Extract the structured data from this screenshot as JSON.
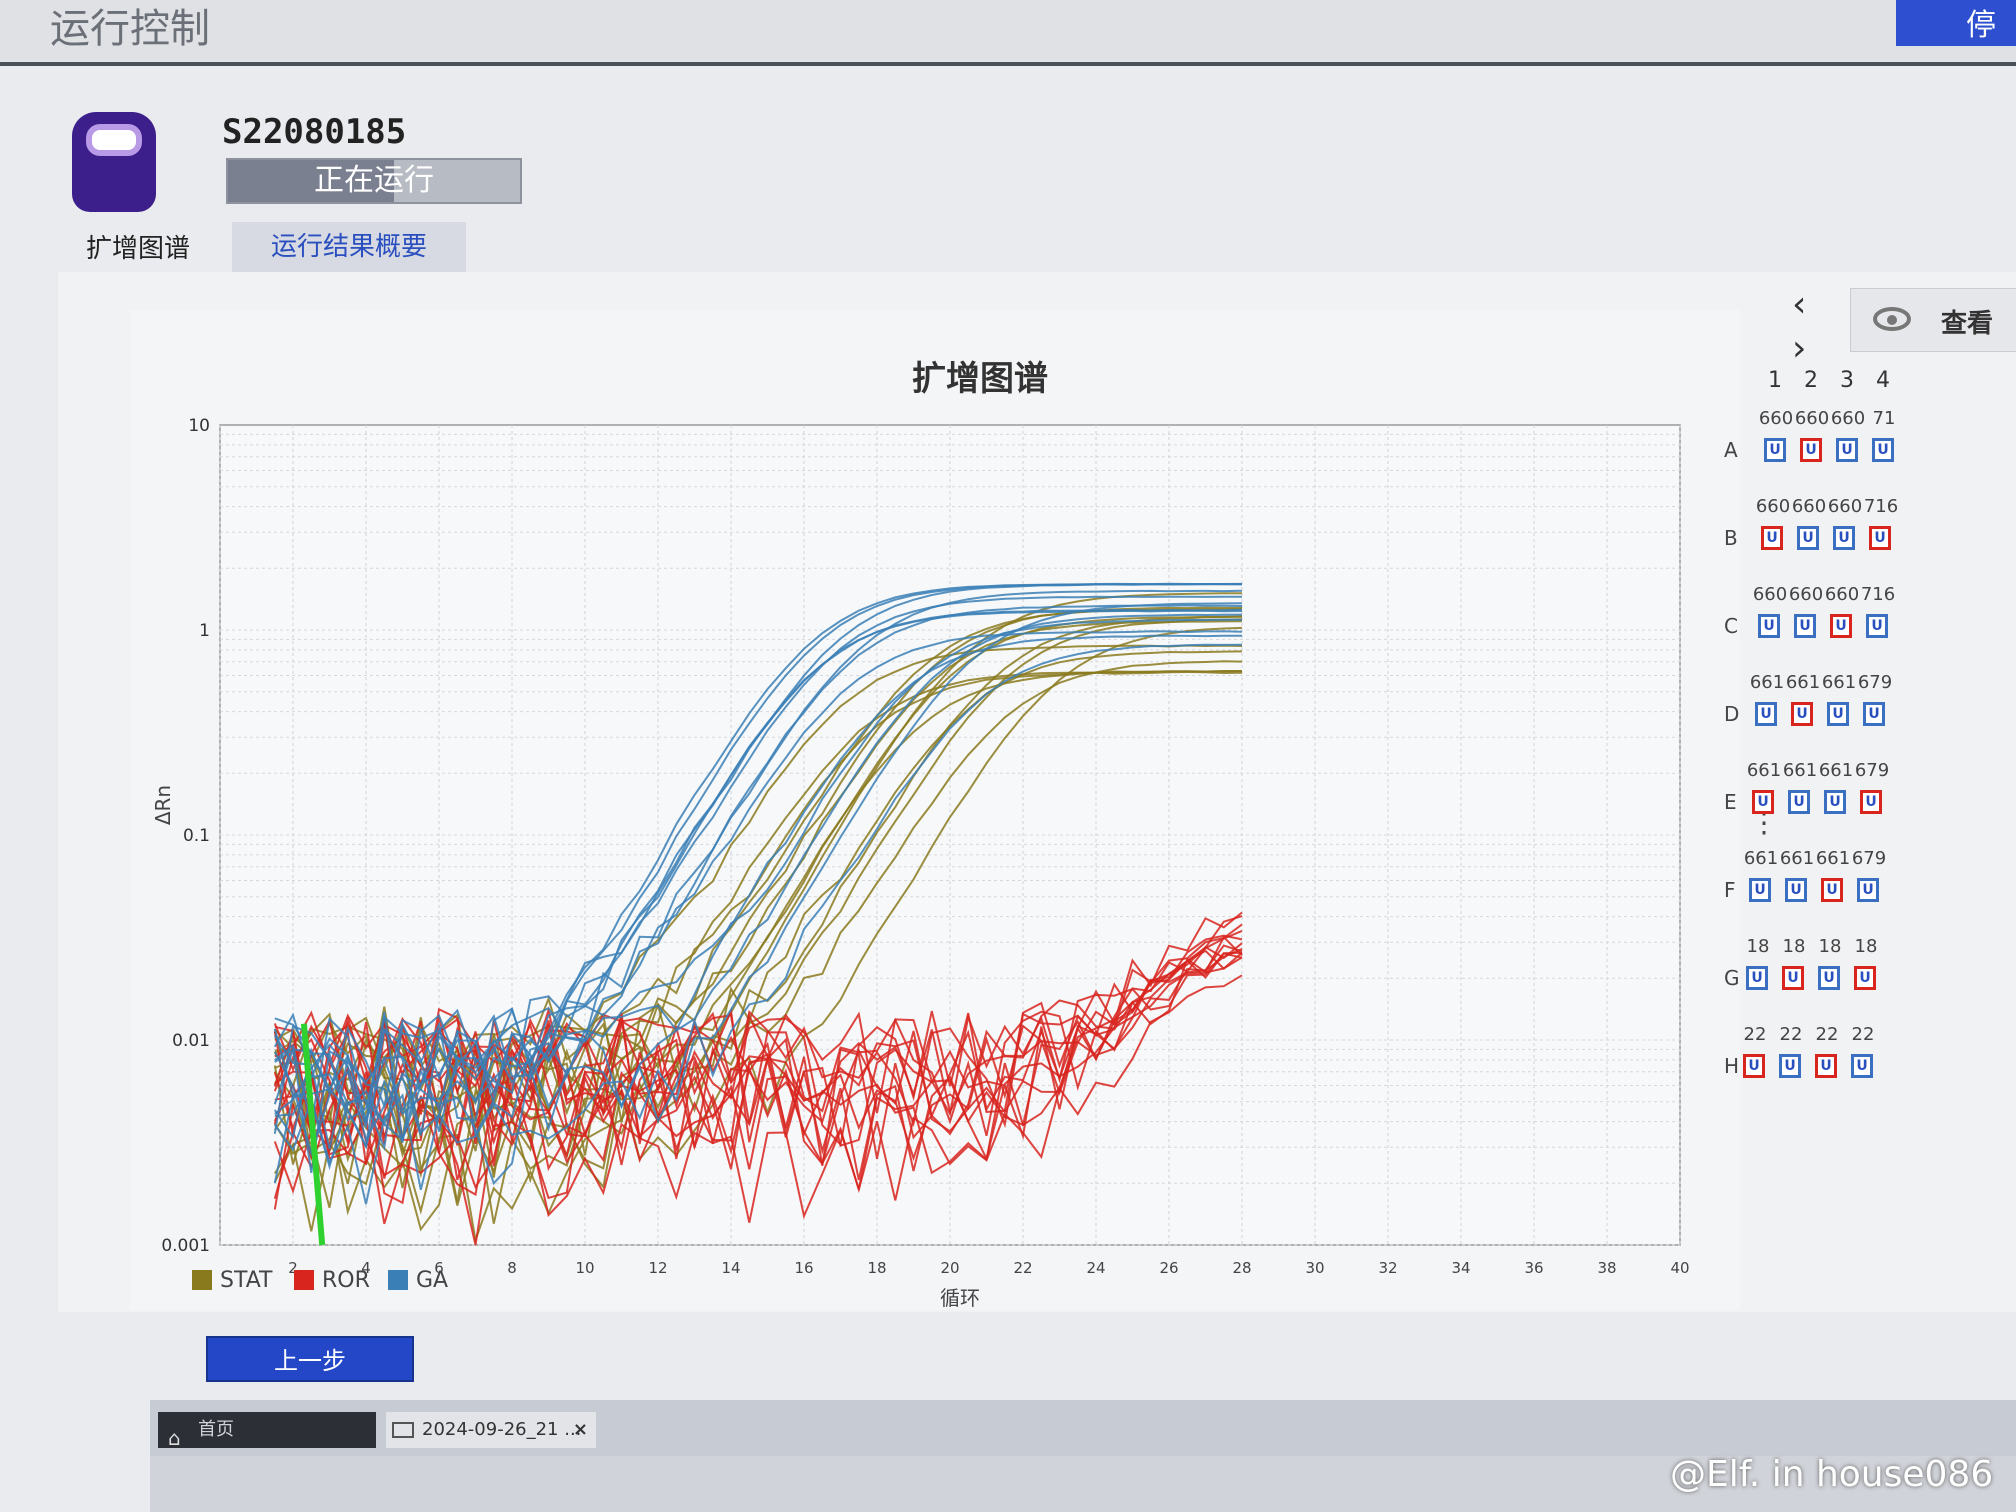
{
  "header": {
    "title": "运行控制",
    "right_button": "停"
  },
  "run": {
    "id": "S22080185",
    "status": "正在运行",
    "progress_fraction": 0.57
  },
  "tabs": [
    {
      "label": "扩增图谱"
    },
    {
      "label": "运行结果概要"
    }
  ],
  "view_button": "查看",
  "back_button": "上一步",
  "taskbar": {
    "home": "首页",
    "file": "2024-09-26_21 ...",
    "close": "×"
  },
  "watermark": "@Elf. in house086",
  "plate": {
    "columns": [
      "1",
      "2",
      "3",
      "4"
    ],
    "rows": [
      {
        "label": "A",
        "wells": [
          "660",
          "660",
          "660",
          "71"
        ]
      },
      {
        "label": "B",
        "wells": [
          "660",
          "660",
          "660",
          "716"
        ]
      },
      {
        "label": "C",
        "wells": [
          "660",
          "660",
          "660",
          "716"
        ]
      },
      {
        "label": "D",
        "wells": [
          "661",
          "661",
          "661",
          "679"
        ]
      },
      {
        "label": "E",
        "wells": [
          "661",
          "661",
          "661",
          "679"
        ]
      },
      {
        "label": "F",
        "wells": [
          "661",
          "661",
          "661",
          "679"
        ]
      },
      {
        "label": "G",
        "wells": [
          "18",
          "18",
          "18",
          "18"
        ]
      },
      {
        "label": "H",
        "wells": [
          "22",
          "22",
          "22",
          "22"
        ]
      }
    ],
    "chip_text": "U"
  },
  "chart_data": {
    "type": "line",
    "title": "扩增图谱",
    "xlabel": "循环",
    "ylabel": "ΔRn",
    "yscale": "log",
    "xlim": [
      0,
      40
    ],
    "ylim": [
      0.001,
      10
    ],
    "x_ticks": [
      "2",
      "4",
      "6",
      "8",
      "10",
      "12",
      "14",
      "16",
      "18",
      "20",
      "22",
      "24",
      "26",
      "28",
      "30",
      "32",
      "34",
      "36",
      "38",
      "40"
    ],
    "y_ticks": [
      "0.001",
      "0.01",
      "0.1",
      "1",
      "10"
    ],
    "grid": true,
    "legend_position": "bottom-left",
    "series": [
      {
        "name": "STAT",
        "color": "#8a7a1e",
        "ct_range": [
          17,
          23
        ],
        "plateau_range": [
          0.6,
          1.6
        ],
        "count": 14
      },
      {
        "name": "ROR",
        "color": "#d8251e",
        "ct_range": [
          26,
          27
        ],
        "plateau_range": [
          0.02,
          0.04
        ],
        "count": 14
      },
      {
        "name": "GA",
        "color": "#3a7fb6",
        "ct_range": [
          16,
          21
        ],
        "plateau_range": [
          0.8,
          1.7
        ],
        "count": 14
      }
    ]
  }
}
